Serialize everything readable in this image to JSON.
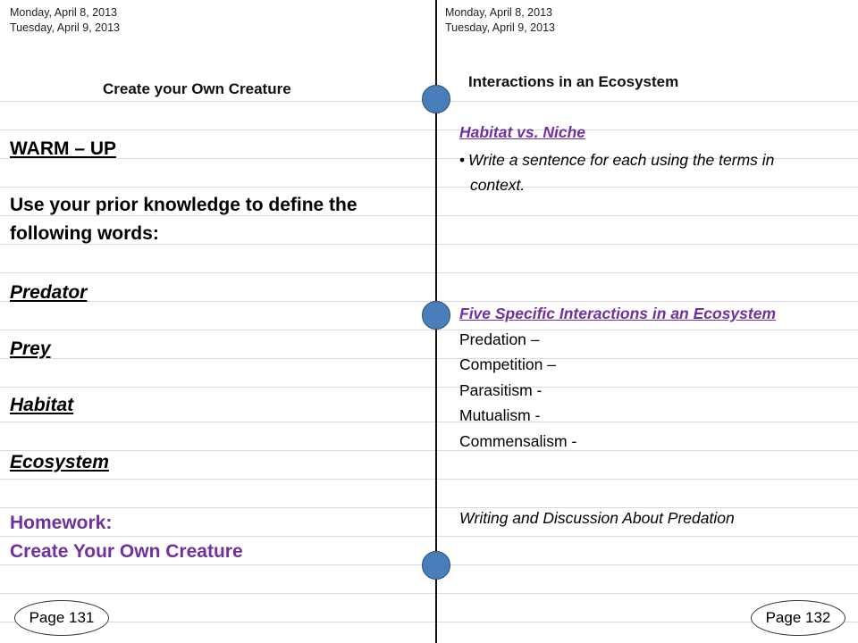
{
  "left_page": {
    "dates": [
      "Monday, April  8, 2013",
      "Tuesday, April 9, 2013"
    ],
    "title": "Create your Own Creature",
    "warmup_heading": "WARM – UP",
    "instruction_line1": "Use your prior knowledge to define the",
    "instruction_line2": "following words:",
    "terms": [
      "Predator",
      "Prey",
      "Habitat",
      "Ecosystem"
    ],
    "homework_label": "Homework:",
    "homework_text": "Create Your Own Creature",
    "page_number": "Page 131"
  },
  "right_page": {
    "dates": [
      "Monday, April  8, 2013",
      "Tuesday, April 9, 2013"
    ],
    "title": "Interactions in an Ecosystem",
    "section1_heading": "Habitat vs. Niche",
    "section1_bullet_line1": "Write a sentence for each using the terms in",
    "section1_bullet_line2": "context.",
    "section2_heading": "Five Specific Interactions  in an Ecosystem",
    "interactions": [
      "Predation –",
      "Competition –",
      "Parasitism -",
      "Mutualism -",
      "Commensalism -"
    ],
    "closing": "Writing and Discussion About Predation",
    "page_number": "Page 132"
  },
  "colors": {
    "accent_purple": "#7030a0",
    "ring_blue": "#4a7ebb"
  },
  "icons": {
    "binder_ring": "binder-ring-icon"
  }
}
